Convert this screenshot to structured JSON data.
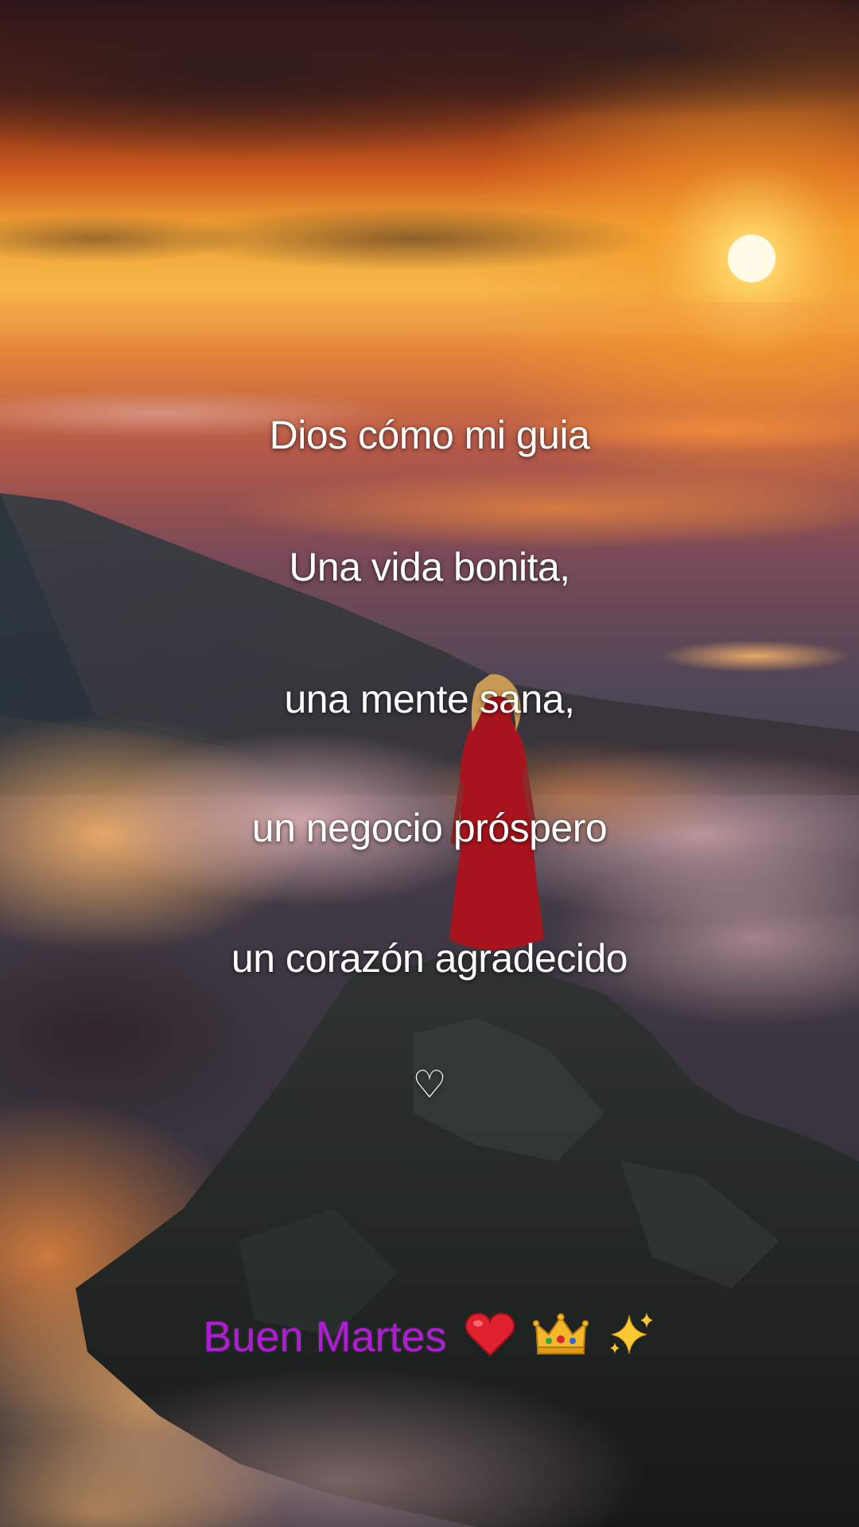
{
  "lines": [
    "Dios cómo mi guia",
    "Una vida bonita,",
    "una mente sana,",
    "un negocio próspero",
    "un corazón agradecido"
  ],
  "heart_symbol": "♡",
  "greeting": {
    "text": "Buen Martes",
    "emojis": [
      "red-heart-icon",
      "crown-icon",
      "sparkles-icon"
    ],
    "color": "#b11ad6"
  },
  "colors": {
    "sky_top": "#3a1a1e",
    "sun": "#fff3c4",
    "horizon": "#f59a2a",
    "dress": "#b3121c"
  }
}
